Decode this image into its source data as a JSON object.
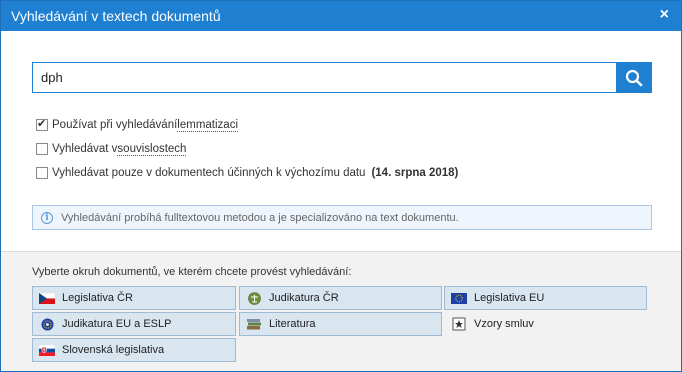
{
  "dialog": {
    "title": "Vyhledávání v textech dokumentů",
    "close_glyph": "×"
  },
  "search": {
    "value": "dph",
    "button_icon": "search-icon"
  },
  "options": [
    {
      "text": "Používat při vyhledávání ",
      "link": "lemmatizaci",
      "checked": true
    },
    {
      "text": "Vyhledávat v ",
      "link": "souvislostech",
      "checked": false
    },
    {
      "text": "Vyhledávat pouze v dokumentech účinných k výchozímu datu",
      "date": "(14. srpna 2018)",
      "checked": false
    }
  ],
  "info": {
    "text": "Vyhledávání probíhá fulltextovou metodou a je specializováno na text dokumentu."
  },
  "scope": {
    "label": "Vyberte okruh dokumentů, ve kterém chcete provést vyhledávání:",
    "items": [
      {
        "label": "Legislativa ČR",
        "icon": "czech-flag-icon",
        "selected": true
      },
      {
        "label": "Judikatura ČR",
        "icon": "court-emblem-icon",
        "selected": true
      },
      {
        "label": "Legislativa EU",
        "icon": "eu-flag-icon",
        "selected": true
      },
      {
        "label": "Judikatura EU a ESLP",
        "icon": "eu-court-emblem-icon",
        "selected": true
      },
      {
        "label": "Literatura",
        "icon": "books-icon",
        "selected": true
      },
      {
        "label": "Vzory smluv",
        "icon": "contract-template-icon",
        "selected": false
      },
      {
        "label": "Slovenská legislativa",
        "icon": "slovak-flag-icon",
        "selected": true
      }
    ]
  },
  "colors": {
    "accent": "#1f7fd0",
    "selected_bg": "#d9e5ef",
    "lower_bg": "#f2f2f2"
  }
}
